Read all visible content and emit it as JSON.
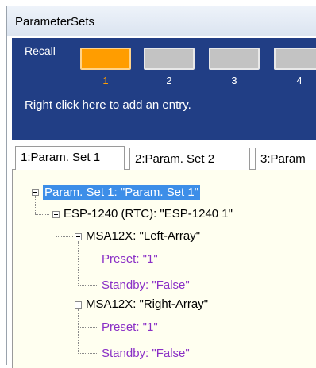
{
  "window": {
    "title": "ParameterSets"
  },
  "recall": {
    "label": "Recall",
    "slots": [
      {
        "number": "1",
        "active": true
      },
      {
        "number": "2",
        "active": false
      },
      {
        "number": "3",
        "active": false
      },
      {
        "number": "4",
        "active": false
      }
    ],
    "hint": "Right click here to add an entry."
  },
  "tabs": [
    {
      "label": "1:Param. Set 1",
      "active": true
    },
    {
      "label": "2:Param. Set 2",
      "active": false
    },
    {
      "label": "3:Param",
      "active": false
    }
  ],
  "tree": {
    "root": "Param. Set 1: \"Param. Set 1\"",
    "device": "ESP-1240 (RTC): \"ESP-1240 1\"",
    "arrays": [
      {
        "label": "MSA12X: \"Left-Array\"",
        "preset": "Preset: \"1\"",
        "standby": "Standby: \"False\""
      },
      {
        "label": "MSA12X: \"Right-Array\"",
        "preset": "Preset: \"1\"",
        "standby": "Standby: \"False\""
      }
    ]
  },
  "colors": {
    "panel_blue": "#213e85",
    "active_orange": "#ff9d00",
    "selection_blue": "#3d8ee8",
    "property_purple": "#8a2fc6",
    "tree_background": "#fffff0"
  }
}
